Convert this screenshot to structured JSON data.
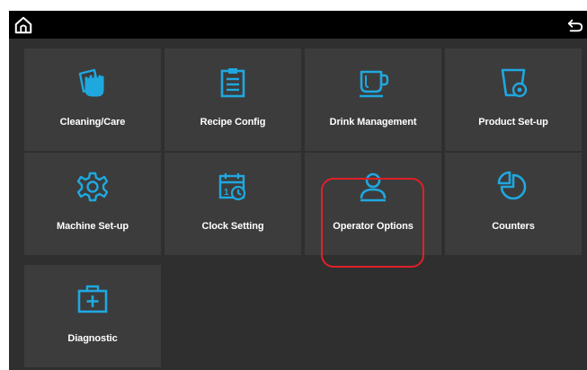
{
  "topbar": {
    "home_icon": "home-icon",
    "back_icon": "back-arrow-icon"
  },
  "tiles": [
    {
      "label": "Cleaning/Care",
      "icon": "cleaning-hand-icon"
    },
    {
      "label": "Recipe Config",
      "icon": "clipboard-icon"
    },
    {
      "label": "Drink Management",
      "icon": "cup-icon"
    },
    {
      "label": "Product Set-up",
      "icon": "container-gear-icon"
    },
    {
      "label": "Machine Set-up",
      "icon": "gear-icon"
    },
    {
      "label": "Clock Setting",
      "icon": "calendar-clock-icon"
    },
    {
      "label": "Operator Options",
      "icon": "user-icon"
    },
    {
      "label": "Counters",
      "icon": "pie-chart-icon"
    },
    {
      "label": "Diagnostic",
      "icon": "first-aid-kit-icon"
    }
  ],
  "colors": {
    "accent": "#1fa8e0",
    "highlight": "#e0202a",
    "tile": "#3c3c3c",
    "background": "#2f2f2f"
  }
}
